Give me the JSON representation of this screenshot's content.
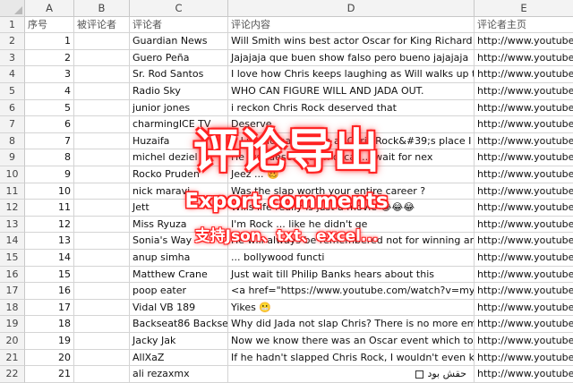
{
  "columns": [
    "A",
    "B",
    "C",
    "D",
    "E"
  ],
  "header_row": {
    "row_num": "1",
    "cells": [
      "序号",
      "被评论者",
      "评论者",
      "评论内容",
      "评论者主页"
    ]
  },
  "rows": [
    {
      "row_num": "2",
      "A": "1",
      "B": "",
      "C": "Guardian News",
      "D": "Will Smith wins best actor Oscar for King Richard ▸ <",
      "E": "http://www.youtube."
    },
    {
      "row_num": "3",
      "A": "2",
      "B": "",
      "C": "Guero Peña",
      "D": "Jajajaja que buen show  falso pero bueno jajajaja",
      "E": "http://www.youtube."
    },
    {
      "row_num": "4",
      "A": "3",
      "B": "",
      "C": "Sr. Rod Santos",
      "D": "I love how Chris keeps laughing as Will walks up to h",
      "E": "http://www.youtube."
    },
    {
      "row_num": "5",
      "A": "4",
      "B": "",
      "C": "Radio Sky",
      "D": "WHO CAN FIGURE WILL AND JADA OUT.",
      "E": "http://www.youtube."
    },
    {
      "row_num": "6",
      "A": "5",
      "B": "",
      "C": "junior jones",
      "D": "i reckon Chris Rock deserved that",
      "E": "http://www.youtube."
    },
    {
      "row_num": "7",
      "A": "6",
      "B": "",
      "C": "charmingICE TV",
      "D": "Deserve",
      "E": "http://www.youtube."
    },
    {
      "row_num": "8",
      "A": "7",
      "B": "",
      "C": "Huzaifa",
      "D": "If I would have been at Chris Rock&#39;s place I wo",
      "E": "http://www.youtube."
    },
    {
      "row_num": "9",
      "A": "8",
      "B": "",
      "C": "michel deziel",
      "D": "He just deserved an oscar.... wait for nex",
      "E": "http://www.youtube."
    },
    {
      "row_num": "10",
      "A": "9",
      "B": "",
      "C": "Rocko Pruden",
      "D": "Jeez ... 🥴",
      "E": "http://www.youtube."
    },
    {
      "row_num": "11",
      "A": "10",
      "B": "",
      "C": "nick maravi",
      "D": "Was the slap worth your entire career ?",
      "E": "http://www.youtube."
    },
    {
      "row_num": "12",
      "A": "11",
      "B": "",
      "C": "Jett",
      "D": "Wills life really is just a movie 😂😂😂",
      "E": "http://www.youtube."
    },
    {
      "row_num": "13",
      "A": "12",
      "B": "",
      "C": "Miss Ryuza",
      "D": "I'm Rock ... like he didn't ge",
      "E": "http://www.youtube."
    },
    {
      "row_num": "14",
      "A": "13",
      "B": "",
      "C": "Sonia's Way",
      "D": "He will always be remembered not for winning an Osc",
      "E": "http://www.youtube."
    },
    {
      "row_num": "15",
      "A": "14",
      "B": "",
      "C": "anup simha",
      "D": "... bollywood functi",
      "E": "http://www.youtube."
    },
    {
      "row_num": "16",
      "A": "15",
      "B": "",
      "C": "Matthew Crane",
      "D": "Just wait till Philip Banks hears about this",
      "E": "http://www.youtube."
    },
    {
      "row_num": "17",
      "A": "16",
      "B": "",
      "C": "poop eater",
      "D": "<a href=\"https://www.youtube.com/watch?v=myjEo",
      "E": "http://www.youtube."
    },
    {
      "row_num": "18",
      "A": "17",
      "B": "",
      "C": "Vidal VB 189",
      "D": "Yikes 😬",
      "E": "http://www.youtube."
    },
    {
      "row_num": "19",
      "A": "18",
      "B": "",
      "C": "Backseat86 Backseat",
      "D": "Why did Jada not slap Chris? There is no more embar",
      "E": "http://www.youtube."
    },
    {
      "row_num": "20",
      "A": "19",
      "B": "",
      "C": "Jacky Jak",
      "D": "Now we know there was an Oscar event which took pl",
      "E": "http://www.youtube."
    },
    {
      "row_num": "21",
      "A": "20",
      "B": "",
      "C": "AllXaZ",
      "D": "If he hadn't slapped Chris Rock, I wouldn't even know",
      "E": "http://www.youtube."
    },
    {
      "row_num": "22",
      "A": "21",
      "B": "",
      "C": "ali rezaxmx",
      "D": "",
      "D_rtl": "حقش بود",
      "E": "http://www.youtube."
    }
  ],
  "overlay": {
    "title": "评论导出",
    "subtitle": "Export comments",
    "formats": "支持Json、txt、excel..."
  },
  "colors": {
    "overlay_text": "#ffffff",
    "overlay_glow": "#ff2020",
    "header_bg": "#f3f3f3",
    "grid_line": "#d4d4d4"
  }
}
